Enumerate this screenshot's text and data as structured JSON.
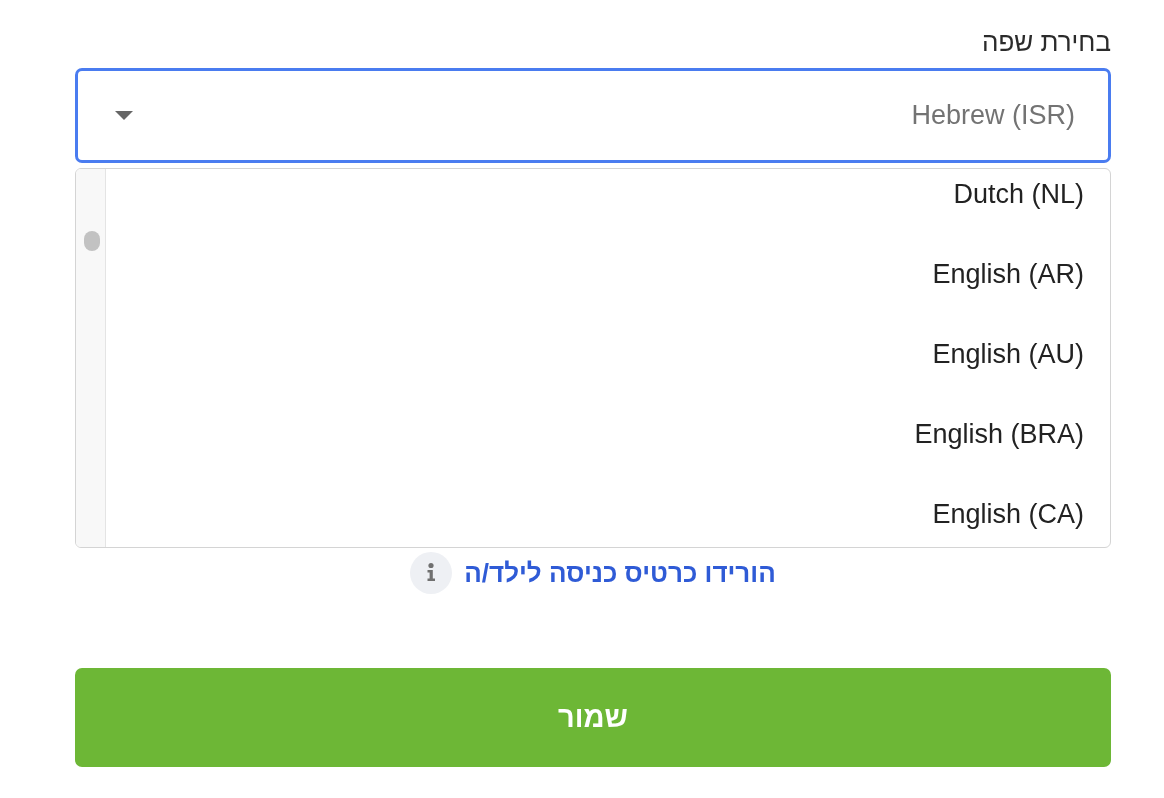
{
  "language_field": {
    "label": "בחירת שפה",
    "value": "Hebrew (ISR)",
    "focused": true
  },
  "dropdown": {
    "options": [
      {
        "label": "Dutch (NL)",
        "selected": false
      },
      {
        "label": "English (AR)",
        "selected": false
      },
      {
        "label": "English (AU)",
        "selected": false
      },
      {
        "label": "English (BRA)",
        "selected": false
      },
      {
        "label": "English (CA)",
        "selected": false
      }
    ]
  },
  "download_link": {
    "text": "הורידו כרטיס כניסה לילד/ה"
  },
  "save_button": {
    "label": "שמור"
  }
}
